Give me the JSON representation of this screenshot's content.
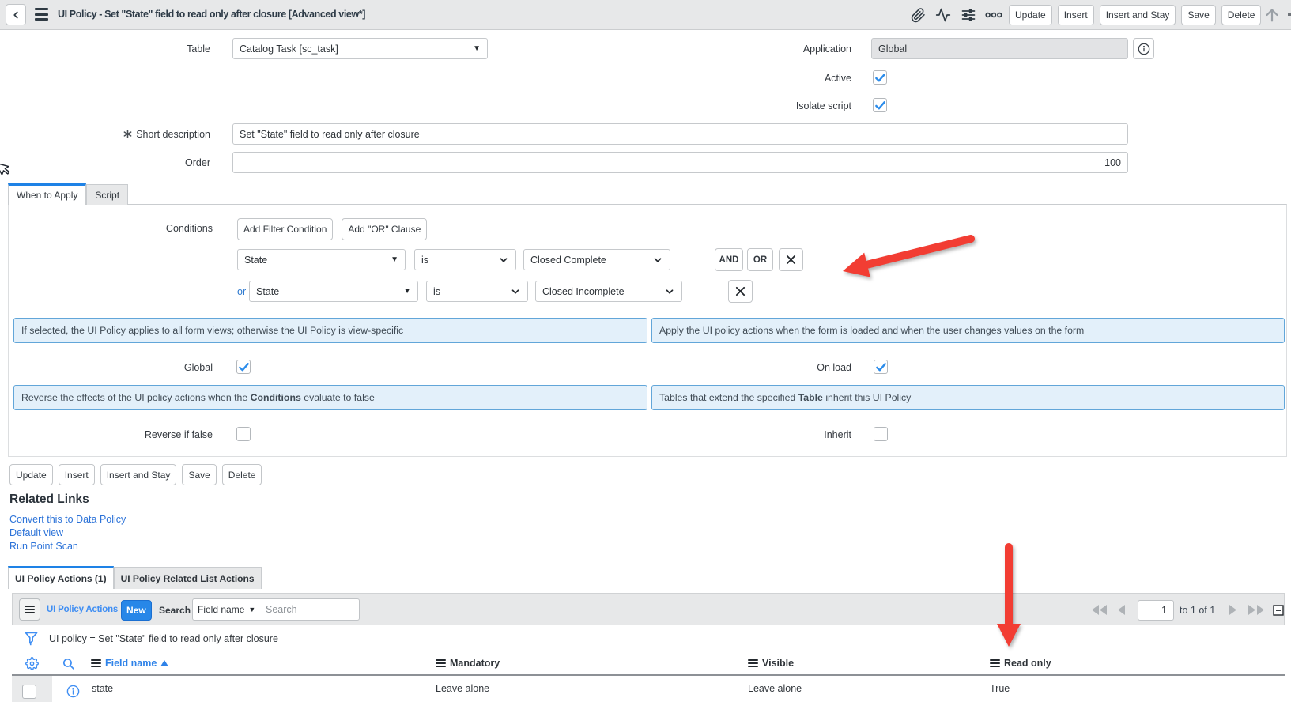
{
  "colors": {
    "accent_blue": "#1e82e6",
    "link_blue": "#2b72d8",
    "list_icon_blue": "#3f8ef3",
    "annotation_bg": "#e3f0fa",
    "annotation_border": "#62a6d9",
    "arrow_red": "#f23d33",
    "header_gray": "#e7e8e9"
  },
  "header": {
    "title": "UI Policy - Set \"State\" field to read only after closure [Advanced view*]",
    "buttons": {
      "update": "Update",
      "insert": "Insert",
      "insert_and_stay": "Insert and Stay",
      "save": "Save",
      "delete": "Delete"
    }
  },
  "form": {
    "table": {
      "label": "Table",
      "value": "Catalog Task [sc_task]"
    },
    "application": {
      "label": "Application",
      "value": "Global"
    },
    "active": {
      "label": "Active",
      "checked": true
    },
    "isolate_script": {
      "label": "Isolate script",
      "checked": true
    },
    "short_description": {
      "label": "Short description",
      "value": "Set \"State\" field to read only after closure"
    },
    "order": {
      "label": "Order",
      "value": "100"
    }
  },
  "tabs": {
    "when_to_apply": "When to Apply",
    "script": "Script"
  },
  "conditions": {
    "label": "Conditions",
    "add_filter_condition": "Add Filter Condition",
    "add_or_clause": "Add \"OR\" Clause",
    "and_label": "AND",
    "or_label": "OR",
    "or_prefix": "or",
    "rows": [
      {
        "field": "State",
        "operator": "is",
        "value": "Closed Complete"
      },
      {
        "field": "State",
        "operator": "is",
        "value": "Closed Incomplete"
      }
    ]
  },
  "annotations": {
    "global_hint": "If selected, the UI Policy applies to all form views; otherwise the UI Policy is view-specific",
    "onload_hint": "Apply the UI policy actions when the form is loaded and when the user changes values on the form",
    "reverse_hint": {
      "pre": "Reverse the effects of the UI policy actions when the ",
      "bold": "Conditions",
      "post": " evaluate to false"
    },
    "inherit_hint": {
      "pre": "Tables that extend the specified ",
      "bold": "Table",
      "post": " inherit this UI Policy"
    }
  },
  "flags": {
    "global": {
      "label": "Global",
      "checked": true
    },
    "on_load": {
      "label": "On load",
      "checked": true
    },
    "reverse_if_false": {
      "label": "Reverse if false",
      "checked": false
    },
    "inherit": {
      "label": "Inherit",
      "checked": false
    }
  },
  "footer_buttons": {
    "update": "Update",
    "insert": "Insert",
    "insert_and_stay": "Insert and Stay",
    "save": "Save",
    "delete": "Delete"
  },
  "related_links": {
    "title": "Related Links",
    "links": [
      "Convert this to Data Policy",
      "Default view",
      "Run Point Scan"
    ]
  },
  "list": {
    "tabs": [
      "UI Policy Actions (1)",
      "UI Policy Related List Actions"
    ],
    "title": "UI Policy Actions",
    "new_button": "New",
    "search_label": "Search",
    "search_field": "Field name",
    "search_placeholder": "Search",
    "pagination": {
      "page": "1",
      "range": "to 1 of 1"
    },
    "filter": "UI policy = Set \"State\" field to read only after closure",
    "columns": {
      "field_name": "Field name",
      "mandatory": "Mandatory",
      "visible": "Visible",
      "read_only": "Read only"
    },
    "rows": [
      {
        "field": "state",
        "mandatory": "Leave alone",
        "visible": "Leave alone",
        "read_only": "True"
      }
    ]
  }
}
